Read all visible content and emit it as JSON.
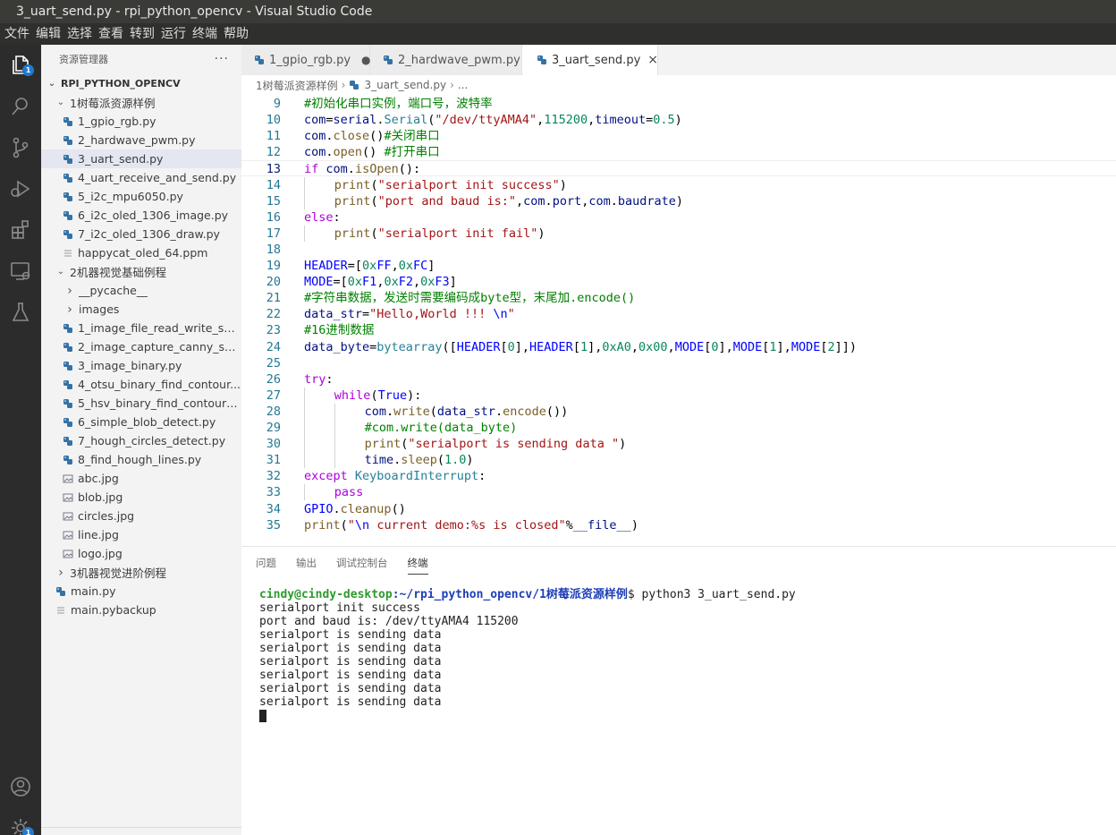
{
  "window": {
    "title": "3_uart_send.py - rpi_python_opencv - Visual Studio Code"
  },
  "menu": [
    "文件",
    "编辑",
    "选择",
    "查看",
    "转到",
    "运行",
    "终端",
    "帮助"
  ],
  "activity_bar": {
    "explorer_badge": "1",
    "settings_badge": "1",
    "items": [
      "files-icon",
      "search-icon",
      "source-control-icon",
      "run-debug-icon",
      "extensions-icon",
      "remote-explorer-icon",
      "testing-icon",
      "account-icon",
      "settings-gear-icon"
    ]
  },
  "sidebar": {
    "header": "资源管理器",
    "more": "···",
    "root": "RPI_PYTHON_OPENCV",
    "items": [
      {
        "label": "1树莓派资源样例",
        "kind": "folder-open",
        "depth": 1
      },
      {
        "label": "1_gpio_rgb.py",
        "kind": "py",
        "depth": 2
      },
      {
        "label": "2_hardwave_pwm.py",
        "kind": "py",
        "depth": 2
      },
      {
        "label": "3_uart_send.py",
        "kind": "py",
        "depth": 2,
        "selected": true
      },
      {
        "label": "4_uart_receive_and_send.py",
        "kind": "py",
        "depth": 2
      },
      {
        "label": "5_i2c_mpu6050.py",
        "kind": "py",
        "depth": 2
      },
      {
        "label": "6_i2c_oled_1306_image.py",
        "kind": "py",
        "depth": 2
      },
      {
        "label": "7_i2c_oled_1306_draw.py",
        "kind": "py",
        "depth": 2
      },
      {
        "label": "happycat_oled_64.ppm",
        "kind": "txt",
        "depth": 2
      },
      {
        "label": "2机器视觉基础例程",
        "kind": "folder-open",
        "depth": 1
      },
      {
        "label": "__pycache__",
        "kind": "folder-closed",
        "depth": 2
      },
      {
        "label": "images",
        "kind": "folder-closed",
        "depth": 2
      },
      {
        "label": "1_image_file_read_write_spl...",
        "kind": "py",
        "depth": 2
      },
      {
        "label": "2_image_capture_canny_sh...",
        "kind": "py",
        "depth": 2
      },
      {
        "label": "3_image_binary.py",
        "kind": "py",
        "depth": 2
      },
      {
        "label": "4_otsu_binary_find_contour...",
        "kind": "py",
        "depth": 2
      },
      {
        "label": "5_hsv_binary_find_contours....",
        "kind": "py",
        "depth": 2
      },
      {
        "label": "6_simple_blob_detect.py",
        "kind": "py",
        "depth": 2
      },
      {
        "label": "7_hough_circles_detect.py",
        "kind": "py",
        "depth": 2
      },
      {
        "label": "8_find_hough_lines.py",
        "kind": "py",
        "depth": 2
      },
      {
        "label": "abc.jpg",
        "kind": "img",
        "depth": 2
      },
      {
        "label": "blob.jpg",
        "kind": "img",
        "depth": 2
      },
      {
        "label": "circles.jpg",
        "kind": "img",
        "depth": 2
      },
      {
        "label": "line.jpg",
        "kind": "img",
        "depth": 2
      },
      {
        "label": "logo.jpg",
        "kind": "img",
        "depth": 2
      },
      {
        "label": "3机器视觉进阶例程",
        "kind": "folder-closed",
        "depth": 1
      },
      {
        "label": "main.py",
        "kind": "py",
        "depth": 1
      },
      {
        "label": "main.pybackup",
        "kind": "txt",
        "depth": 1
      }
    ]
  },
  "tabs": [
    {
      "label": "1_gpio_rgb.py",
      "state": "modified",
      "mark": "●"
    },
    {
      "label": "2_hardwave_pwm.py",
      "state": "normal",
      "mark": ""
    },
    {
      "label": "3_uart_send.py",
      "state": "active",
      "mark": "×"
    }
  ],
  "breadcrumb": [
    "1树莓派资源样例",
    "3_uart_send.py",
    "..."
  ],
  "editor": {
    "current_line": 13,
    "lines": [
      {
        "n": 9,
        "indent": 0,
        "tokens": [
          [
            "cmt",
            "#初始化串口实例，端口号，波特率"
          ]
        ]
      },
      {
        "n": 10,
        "indent": 0,
        "tokens": [
          [
            "id",
            "com"
          ],
          [
            "plain",
            "="
          ],
          [
            "id",
            "serial"
          ],
          [
            "plain",
            "."
          ],
          [
            "cls",
            "Serial"
          ],
          [
            "plain",
            "("
          ],
          [
            "str",
            "\"/dev/ttyAMA4\""
          ],
          [
            "plain",
            ","
          ],
          [
            "num",
            "115200"
          ],
          [
            "plain",
            ","
          ],
          [
            "id",
            "timeout"
          ],
          [
            "plain",
            "="
          ],
          [
            "num",
            "0.5"
          ],
          [
            "plain",
            ")"
          ]
        ]
      },
      {
        "n": 11,
        "indent": 0,
        "tokens": [
          [
            "id",
            "com"
          ],
          [
            "plain",
            "."
          ],
          [
            "fn",
            "close"
          ],
          [
            "plain",
            "()"
          ],
          [
            "cmt",
            "#关闭串口"
          ]
        ]
      },
      {
        "n": 12,
        "indent": 0,
        "tokens": [
          [
            "id",
            "com"
          ],
          [
            "plain",
            "."
          ],
          [
            "fn",
            "open"
          ],
          [
            "plain",
            "() "
          ],
          [
            "cmt",
            "#打开串口"
          ]
        ]
      },
      {
        "n": 13,
        "indent": 0,
        "tokens": [
          [
            "kw",
            "if"
          ],
          [
            "plain",
            " "
          ],
          [
            "id",
            "com"
          ],
          [
            "plain",
            "."
          ],
          [
            "fn",
            "isOpen"
          ],
          [
            "plain",
            "():"
          ]
        ]
      },
      {
        "n": 14,
        "indent": 1,
        "tokens": [
          [
            "fn",
            "print"
          ],
          [
            "plain",
            "("
          ],
          [
            "str",
            "\"serialport init success\""
          ],
          [
            "plain",
            ")"
          ]
        ]
      },
      {
        "n": 15,
        "indent": 1,
        "tokens": [
          [
            "fn",
            "print"
          ],
          [
            "plain",
            "("
          ],
          [
            "str",
            "\"port and baud is:\""
          ],
          [
            "plain",
            ","
          ],
          [
            "id",
            "com"
          ],
          [
            "plain",
            "."
          ],
          [
            "id",
            "port"
          ],
          [
            "plain",
            ","
          ],
          [
            "id",
            "com"
          ],
          [
            "plain",
            "."
          ],
          [
            "id",
            "baudrate"
          ],
          [
            "plain",
            ")"
          ]
        ]
      },
      {
        "n": 16,
        "indent": 0,
        "tokens": [
          [
            "kw",
            "else"
          ],
          [
            "plain",
            ":"
          ]
        ]
      },
      {
        "n": 17,
        "indent": 1,
        "tokens": [
          [
            "fn",
            "print"
          ],
          [
            "plain",
            "("
          ],
          [
            "str",
            "\"serialport init fail\""
          ],
          [
            "plain",
            ")"
          ]
        ]
      },
      {
        "n": 18,
        "indent": 0,
        "tokens": []
      },
      {
        "n": 19,
        "indent": 0,
        "tokens": [
          [
            "const",
            "HEADER"
          ],
          [
            "plain",
            "=["
          ],
          [
            "num",
            "0x"
          ],
          [
            "const",
            "FF"
          ],
          [
            "plain",
            ","
          ],
          [
            "num",
            "0x"
          ],
          [
            "const",
            "FC"
          ],
          [
            "plain",
            "]"
          ]
        ]
      },
      {
        "n": 20,
        "indent": 0,
        "tokens": [
          [
            "const",
            "MODE"
          ],
          [
            "plain",
            "=["
          ],
          [
            "num",
            "0x"
          ],
          [
            "const",
            "F1"
          ],
          [
            "plain",
            ","
          ],
          [
            "num",
            "0x"
          ],
          [
            "const",
            "F2"
          ],
          [
            "plain",
            ","
          ],
          [
            "num",
            "0x"
          ],
          [
            "const",
            "F3"
          ],
          [
            "plain",
            "]"
          ]
        ]
      },
      {
        "n": 21,
        "indent": 0,
        "tokens": [
          [
            "cmt",
            "#字符串数据，发送时需要编码成byte型，末尾加.encode()"
          ]
        ]
      },
      {
        "n": 22,
        "indent": 0,
        "tokens": [
          [
            "id",
            "data_str"
          ],
          [
            "plain",
            "="
          ],
          [
            "str",
            "\"Hello,World !!! "
          ],
          [
            "const",
            "\\n"
          ],
          [
            "str",
            "\""
          ]
        ]
      },
      {
        "n": 23,
        "indent": 0,
        "tokens": [
          [
            "cmt",
            "#16进制数据"
          ]
        ]
      },
      {
        "n": 24,
        "indent": 0,
        "tokens": [
          [
            "id",
            "data_byte"
          ],
          [
            "plain",
            "="
          ],
          [
            "cls",
            "bytearray"
          ],
          [
            "plain",
            "(["
          ],
          [
            "const",
            "HEADER"
          ],
          [
            "plain",
            "["
          ],
          [
            "num",
            "0"
          ],
          [
            "plain",
            "],"
          ],
          [
            "const",
            "HEADER"
          ],
          [
            "plain",
            "["
          ],
          [
            "num",
            "1"
          ],
          [
            "plain",
            "],"
          ],
          [
            "num",
            "0xA0"
          ],
          [
            "plain",
            ","
          ],
          [
            "num",
            "0x00"
          ],
          [
            "plain",
            ","
          ],
          [
            "const",
            "MODE"
          ],
          [
            "plain",
            "["
          ],
          [
            "num",
            "0"
          ],
          [
            "plain",
            "],"
          ],
          [
            "const",
            "MODE"
          ],
          [
            "plain",
            "["
          ],
          [
            "num",
            "1"
          ],
          [
            "plain",
            "],"
          ],
          [
            "const",
            "MODE"
          ],
          [
            "plain",
            "["
          ],
          [
            "num",
            "2"
          ],
          [
            "plain",
            "]])"
          ]
        ]
      },
      {
        "n": 25,
        "indent": 0,
        "tokens": []
      },
      {
        "n": 26,
        "indent": 0,
        "tokens": [
          [
            "kw",
            "try"
          ],
          [
            "plain",
            ":"
          ]
        ]
      },
      {
        "n": 27,
        "indent": 1,
        "tokens": [
          [
            "kw",
            "while"
          ],
          [
            "plain",
            "("
          ],
          [
            "const",
            "True"
          ],
          [
            "plain",
            "):"
          ]
        ]
      },
      {
        "n": 28,
        "indent": 2,
        "tokens": [
          [
            "id",
            "com"
          ],
          [
            "plain",
            "."
          ],
          [
            "fn",
            "write"
          ],
          [
            "plain",
            "("
          ],
          [
            "id",
            "data_str"
          ],
          [
            "plain",
            "."
          ],
          [
            "fn",
            "encode"
          ],
          [
            "plain",
            "())"
          ]
        ]
      },
      {
        "n": 29,
        "indent": 2,
        "tokens": [
          [
            "cmt",
            "#com.write(data_byte)"
          ]
        ]
      },
      {
        "n": 30,
        "indent": 2,
        "tokens": [
          [
            "fn",
            "print"
          ],
          [
            "plain",
            "("
          ],
          [
            "str",
            "\"serialport is sending data \""
          ],
          [
            "plain",
            ")"
          ]
        ]
      },
      {
        "n": 31,
        "indent": 2,
        "tokens": [
          [
            "id",
            "time"
          ],
          [
            "plain",
            "."
          ],
          [
            "fn",
            "sleep"
          ],
          [
            "plain",
            "("
          ],
          [
            "num",
            "1.0"
          ],
          [
            "plain",
            ")"
          ]
        ]
      },
      {
        "n": 32,
        "indent": 0,
        "tokens": [
          [
            "kw",
            "except"
          ],
          [
            "plain",
            " "
          ],
          [
            "cls",
            "KeyboardInterrupt"
          ],
          [
            "plain",
            ":"
          ]
        ]
      },
      {
        "n": 33,
        "indent": 1,
        "tokens": [
          [
            "kw",
            "pass"
          ]
        ]
      },
      {
        "n": 34,
        "indent": 0,
        "tokens": [
          [
            "const",
            "GPIO"
          ],
          [
            "plain",
            "."
          ],
          [
            "fn",
            "cleanup"
          ],
          [
            "plain",
            "()"
          ]
        ]
      },
      {
        "n": 35,
        "indent": 0,
        "tokens": [
          [
            "fn",
            "print"
          ],
          [
            "plain",
            "("
          ],
          [
            "str",
            "\""
          ],
          [
            "const",
            "\\n"
          ],
          [
            "str",
            " current demo:%s is closed\""
          ],
          [
            "plain",
            "%"
          ],
          [
            "id",
            "__file__"
          ],
          [
            "plain",
            ")"
          ]
        ]
      }
    ]
  },
  "panel": {
    "tabs": [
      {
        "label": "问题",
        "active": false
      },
      {
        "label": "输出",
        "active": false
      },
      {
        "label": "调试控制台",
        "active": false
      },
      {
        "label": "终端",
        "active": true
      }
    ],
    "terminal": {
      "prompt_user": "cindy@cindy-desktop",
      "prompt_path": ":~/rpi_python_opencv/1树莓派资源样例",
      "command": "$ python3 3_uart_send.py",
      "output": [
        "serialport init success",
        "port and baud is: /dev/ttyAMA4 115200",
        "serialport is sending data",
        "serialport is sending data",
        "serialport is sending data",
        "serialport is sending data",
        "serialport is sending data",
        "serialport is sending data"
      ]
    }
  },
  "colors": {
    "accent": "#1f7ad1",
    "python_icon": "#3572a5",
    "selected_row": "#e4e6f1"
  }
}
